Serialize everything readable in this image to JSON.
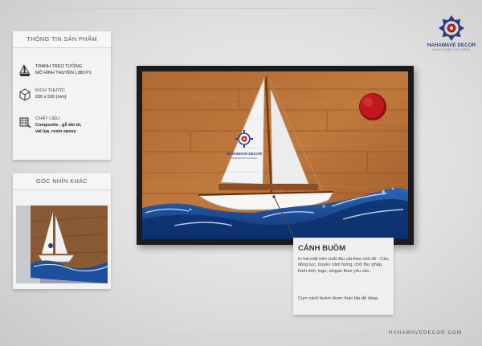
{
  "brand": {
    "name": "HAHAWAVE DECOR",
    "tagline": "KINH DOANH CAO BẰNG",
    "website": "HAHAWAVEDECOR.COM",
    "accent_color": "#2a3e86"
  },
  "product_panel": {
    "title": "THÔNG TIN SẢN PHẨM",
    "items": [
      {
        "icon": "sailboat-icon",
        "label": "",
        "value_lines": [
          "TRANH TREO TƯỜNG",
          "MÔ HÌNH THUYỀN L380.P1"
        ]
      },
      {
        "icon": "dimensions-icon",
        "label": "KÍCH THƯỚC",
        "value_lines": [
          "830 x 530  (mm)"
        ]
      },
      {
        "icon": "material-icon",
        "label": "CHẤT LIỆU",
        "value_lines": [
          "Composite , gỗ tần bì,",
          "vải lụa, resin epoxy"
        ]
      }
    ]
  },
  "alt_view_panel": {
    "title": "GÓC NHÌN KHÁC"
  },
  "artwork": {
    "sail_logo_text": "HAHAWAVE DECOR",
    "sail_logo_sub": "WAVE DECOR CAO BẰNG",
    "sun_color": "#c0181f",
    "wave_color": "#1d4f9e"
  },
  "callout": {
    "title": "CÁNH BUỒM",
    "description": "In hai mặt trên chất liệu vải theo chủ đề  : Câu động lực, truyền cảm hứng, chữ thư pháp, hình ảnh, logo, slogan theo yêu cầu",
    "note": "Cụm cánh buồm được tháo lắp dễ dàng"
  }
}
